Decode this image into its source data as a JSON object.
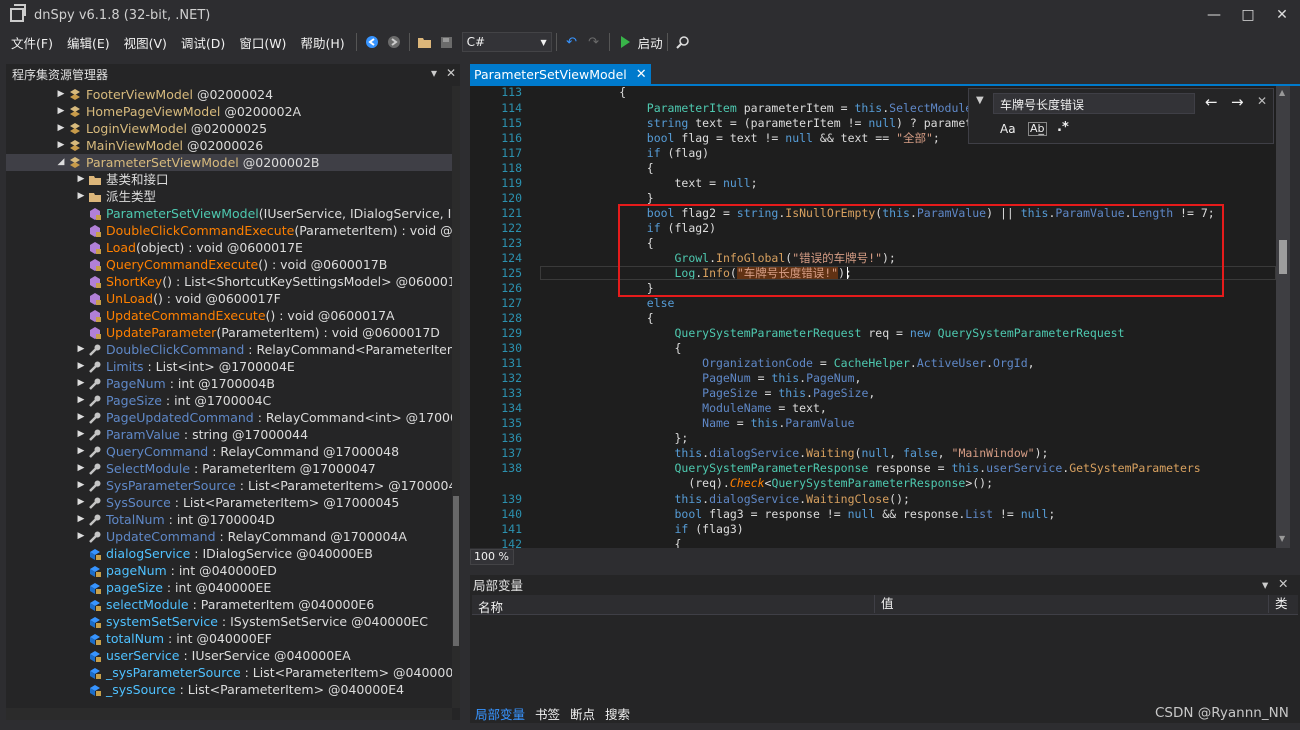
{
  "window": {
    "title": "dnSpy v6.1.8 (32-bit, .NET)",
    "minimize": "—",
    "maximize": "□",
    "close": "✕"
  },
  "menu": [
    "文件(F)",
    "编辑(E)",
    "视图(V)",
    "调试(D)",
    "窗口(W)",
    "帮助(H)"
  ],
  "toolbar": {
    "language": "C#",
    "start_label": "启动",
    "icons": [
      "back-icon",
      "forward-icon",
      "open-icon",
      "save-all-icon",
      "undo-icon",
      "redo-icon",
      "start-icon",
      "search-icon"
    ]
  },
  "explorer": {
    "title": "程序集资源管理器",
    "items": [
      {
        "name": "FooterViewModel",
        "suffix": " @02000024",
        "kind": "class"
      },
      {
        "name": "HomePageViewModel",
        "suffix": " @0200002A",
        "kind": "class"
      },
      {
        "name": "LoginViewModel",
        "suffix": " @02000025",
        "kind": "class"
      },
      {
        "name": "MainViewModel",
        "suffix": " @02000026",
        "kind": "class"
      },
      {
        "name": "ParameterSetViewModel",
        "suffix": " @0200002B",
        "kind": "class-open"
      },
      {
        "name": "基类和接口",
        "suffix": "",
        "kind": "folder"
      },
      {
        "name": "派生类型",
        "suffix": "",
        "kind": "folder"
      },
      {
        "name": "ParameterSetViewModel",
        "suffix": "(IUserService, IDialogService, IS",
        "kind": "ctor"
      },
      {
        "name": "DoubleClickCommandExecute",
        "suffix": "(ParameterItem) : void @0",
        "kind": "method"
      },
      {
        "name": "Load",
        "suffix": "(object) : void @0600017E",
        "kind": "method"
      },
      {
        "name": "QueryCommandExecute",
        "suffix": "() : void @0600017B",
        "kind": "method"
      },
      {
        "name": "ShortKey",
        "suffix": "() : List<ShortcutKeySettingsModel> @0600018",
        "kind": "method"
      },
      {
        "name": "UnLoad",
        "suffix": "() : void @0600017F",
        "kind": "method"
      },
      {
        "name": "UpdateCommandExecute",
        "suffix": "() : void @0600017A",
        "kind": "method"
      },
      {
        "name": "UpdateParameter",
        "suffix": "(ParameterItem) : void @0600017D",
        "kind": "method"
      },
      {
        "name": "DoubleClickCommand",
        "suffix": " : RelayCommand<ParameterItem",
        "kind": "prop"
      },
      {
        "name": "Limits",
        "suffix": " : List<int> @1700004E",
        "kind": "prop"
      },
      {
        "name": "PageNum",
        "suffix": " : int @1700004B",
        "kind": "prop"
      },
      {
        "name": "PageSize",
        "suffix": " : int @1700004C",
        "kind": "prop"
      },
      {
        "name": "PageUpdatedCommand",
        "suffix": " : RelayCommand<int> @17000",
        "kind": "prop"
      },
      {
        "name": "ParamValue",
        "suffix": " : string @17000044",
        "kind": "prop"
      },
      {
        "name": "QueryCommand",
        "suffix": " : RelayCommand @17000048",
        "kind": "prop"
      },
      {
        "name": "SelectModule",
        "suffix": " : ParameterItem @17000047",
        "kind": "prop"
      },
      {
        "name": "SysParameterSource",
        "suffix": " : List<ParameterItem> @17000046",
        "kind": "prop"
      },
      {
        "name": "SysSource",
        "suffix": " : List<ParameterItem> @17000045",
        "kind": "prop"
      },
      {
        "name": "TotalNum",
        "suffix": " : int @1700004D",
        "kind": "prop"
      },
      {
        "name": "UpdateCommand",
        "suffix": " : RelayCommand @1700004A",
        "kind": "prop"
      },
      {
        "name": "dialogService",
        "suffix": " : IDialogService @040000EB",
        "kind": "field"
      },
      {
        "name": "pageNum",
        "suffix": " : int @040000ED",
        "kind": "field"
      },
      {
        "name": "pageSize",
        "suffix": " : int @040000EE",
        "kind": "field"
      },
      {
        "name": "selectModule",
        "suffix": " : ParameterItem @040000E6",
        "kind": "field"
      },
      {
        "name": "systemSetService",
        "suffix": " : ISystemSetService @040000EC",
        "kind": "field"
      },
      {
        "name": "totalNum",
        "suffix": " : int @040000EF",
        "kind": "field"
      },
      {
        "name": "userService",
        "suffix": " : IUserService @040000EA",
        "kind": "field"
      },
      {
        "name": "_sysParameterSource",
        "suffix": " : List<ParameterItem> @040000E",
        "kind": "field"
      },
      {
        "name": "_sysSource",
        "suffix": " : List<ParameterItem> @040000E4",
        "kind": "field"
      }
    ]
  },
  "editor": {
    "tab_title": "ParameterSetViewModel",
    "zoom": "100 %",
    "find_text": "车牌号长度错误",
    "find_options": [
      "Aa",
      "Ab̲",
      ".*"
    ],
    "lines": [
      {
        "n": "113",
        "code": [
          [
            "p",
            "            {"
          ]
        ]
      },
      {
        "n": "114",
        "code": [
          [
            "t",
            "                ParameterItem"
          ],
          [
            "p",
            " parameterItem = "
          ],
          [
            "k",
            "this"
          ],
          [
            "p",
            "."
          ],
          [
            "p2",
            "SelectModule"
          ],
          [
            "p",
            ";"
          ]
        ]
      },
      {
        "n": "115",
        "code": [
          [
            "k",
            "                string"
          ],
          [
            "p",
            " text = (parameterItem != "
          ],
          [
            "k",
            "null"
          ],
          [
            "p",
            ") ? parameter"
          ]
        ]
      },
      {
        "n": "116",
        "code": [
          [
            "k",
            "                bool"
          ],
          [
            "p",
            " flag = text != "
          ],
          [
            "k",
            "null"
          ],
          [
            "p",
            " && text == "
          ],
          [
            "s",
            "\"全部\""
          ],
          [
            "p",
            ";"
          ]
        ]
      },
      {
        "n": "117",
        "code": [
          [
            "k",
            "                if"
          ],
          [
            "p",
            " (flag)"
          ]
        ]
      },
      {
        "n": "118",
        "code": [
          [
            "p",
            "                {"
          ]
        ]
      },
      {
        "n": "119",
        "code": [
          [
            "p",
            "                    text = "
          ],
          [
            "k",
            "null"
          ],
          [
            "p",
            ";"
          ]
        ]
      },
      {
        "n": "120",
        "code": [
          [
            "p",
            "                }"
          ]
        ]
      },
      {
        "n": "121",
        "code": [
          [
            "k",
            "                bool"
          ],
          [
            "p",
            " flag2 = "
          ],
          [
            "k",
            "string"
          ],
          [
            "p",
            "."
          ],
          [
            "m",
            "IsNullOrEmpty"
          ],
          [
            "p",
            "("
          ],
          [
            "k",
            "this"
          ],
          [
            "p",
            "."
          ],
          [
            "p2",
            "ParamValue"
          ],
          [
            "p",
            ") || "
          ],
          [
            "k",
            "this"
          ],
          [
            "p",
            "."
          ],
          [
            "p2",
            "ParamValue"
          ],
          [
            "p",
            "."
          ],
          [
            "p2",
            "Length"
          ],
          [
            "p",
            " != 7;"
          ]
        ]
      },
      {
        "n": "122",
        "code": [
          [
            "k",
            "                if"
          ],
          [
            "p",
            " (flag2)"
          ]
        ]
      },
      {
        "n": "123",
        "code": [
          [
            "p",
            "                {"
          ]
        ]
      },
      {
        "n": "124",
        "code": [
          [
            "t",
            "                    Growl"
          ],
          [
            "p",
            "."
          ],
          [
            "m",
            "InfoGlobal"
          ],
          [
            "p",
            "("
          ],
          [
            "s",
            "\"错误的车牌号!\""
          ],
          [
            "p",
            ");"
          ]
        ]
      },
      {
        "n": "125",
        "code": [
          [
            "t",
            "                    Log"
          ],
          [
            "p",
            "."
          ],
          [
            "m",
            "Info"
          ],
          [
            "p",
            "("
          ],
          [
            "hs",
            "\"车牌号长度错误!\""
          ],
          [
            "p",
            ");"
          ]
        ]
      },
      {
        "n": "126",
        "code": [
          [
            "p",
            "                }"
          ]
        ]
      },
      {
        "n": "127",
        "code": [
          [
            "k",
            "                else"
          ]
        ]
      },
      {
        "n": "128",
        "code": [
          [
            "p",
            "                {"
          ]
        ]
      },
      {
        "n": "129",
        "code": [
          [
            "t",
            "                    QuerySystemParameterRequest"
          ],
          [
            "p",
            " req = "
          ],
          [
            "k",
            "new"
          ],
          [
            "t",
            " QuerySystemParameterRequest"
          ]
        ]
      },
      {
        "n": "130",
        "code": [
          [
            "p",
            "                    {"
          ]
        ]
      },
      {
        "n": "131",
        "code": [
          [
            "p2",
            "                        OrganizationCode"
          ],
          [
            "p",
            " = "
          ],
          [
            "t",
            "CacheHelper"
          ],
          [
            "p",
            "."
          ],
          [
            "p2",
            "ActiveUser"
          ],
          [
            "p",
            "."
          ],
          [
            "p2",
            "OrgId"
          ],
          [
            "p",
            ","
          ]
        ]
      },
      {
        "n": "132",
        "code": [
          [
            "p2",
            "                        PageNum"
          ],
          [
            "p",
            " = "
          ],
          [
            "k",
            "this"
          ],
          [
            "p",
            "."
          ],
          [
            "p2",
            "PageNum"
          ],
          [
            "p",
            ","
          ]
        ]
      },
      {
        "n": "133",
        "code": [
          [
            "p2",
            "                        PageSize"
          ],
          [
            "p",
            " = "
          ],
          [
            "k",
            "this"
          ],
          [
            "p",
            "."
          ],
          [
            "p2",
            "PageSize"
          ],
          [
            "p",
            ","
          ]
        ]
      },
      {
        "n": "134",
        "code": [
          [
            "p2",
            "                        ModuleName"
          ],
          [
            "p",
            " = text,"
          ]
        ]
      },
      {
        "n": "135",
        "code": [
          [
            "p2",
            "                        Name"
          ],
          [
            "p",
            " = "
          ],
          [
            "k",
            "this"
          ],
          [
            "p",
            "."
          ],
          [
            "p2",
            "ParamValue"
          ]
        ]
      },
      {
        "n": "136",
        "code": [
          [
            "p",
            "                    };"
          ]
        ]
      },
      {
        "n": "137",
        "code": [
          [
            "k",
            "                    this"
          ],
          [
            "p",
            "."
          ],
          [
            "fld",
            "dialogService"
          ],
          [
            "p",
            "."
          ],
          [
            "m",
            "Waiting"
          ],
          [
            "p",
            "("
          ],
          [
            "k",
            "null"
          ],
          [
            "p",
            ", "
          ],
          [
            "k",
            "false"
          ],
          [
            "p",
            ", "
          ],
          [
            "s",
            "\"MainWindow\""
          ],
          [
            "p",
            ");"
          ]
        ]
      },
      {
        "n": "138",
        "code": [
          [
            "t",
            "                    QuerySystemParameterResponse"
          ],
          [
            "p",
            " response = "
          ],
          [
            "k",
            "this"
          ],
          [
            "p",
            "."
          ],
          [
            "fld",
            "userService"
          ],
          [
            "p",
            "."
          ],
          [
            "m",
            "GetSystemParameters"
          ]
        ]
      },
      {
        "n": "",
        "code": [
          [
            "p",
            "                      (req)."
          ],
          [
            "f",
            "Check"
          ],
          [
            "p",
            "<"
          ],
          [
            "t",
            "QuerySystemParameterResponse"
          ],
          [
            "p",
            ">();"
          ]
        ]
      },
      {
        "n": "139",
        "code": [
          [
            "k",
            "                    this"
          ],
          [
            "p",
            "."
          ],
          [
            "fld",
            "dialogService"
          ],
          [
            "p",
            "."
          ],
          [
            "m",
            "WaitingClose"
          ],
          [
            "p",
            "();"
          ]
        ]
      },
      {
        "n": "140",
        "code": [
          [
            "k",
            "                    bool"
          ],
          [
            "p",
            " flag3 = response != "
          ],
          [
            "k",
            "null"
          ],
          [
            "p",
            " && response."
          ],
          [
            "p2",
            "List"
          ],
          [
            "p",
            " != "
          ],
          [
            "k",
            "null"
          ],
          [
            "p",
            ";"
          ]
        ]
      },
      {
        "n": "141",
        "code": [
          [
            "k",
            "                    if"
          ],
          [
            "p",
            " (flag3)"
          ]
        ]
      },
      {
        "n": "142",
        "code": [
          [
            "p",
            "                    {"
          ]
        ]
      }
    ]
  },
  "locals": {
    "title": "局部变量",
    "columns": [
      "名称",
      "值",
      "类"
    ]
  },
  "bottom_tabs": [
    "局部变量",
    "书签",
    "断点",
    "搜索"
  ],
  "watermark": "CSDN @Ryannn_NN",
  "colors": {
    "accent": "#007acc",
    "highlight_box": "#e61b1b",
    "background": "#1e1e1e"
  }
}
